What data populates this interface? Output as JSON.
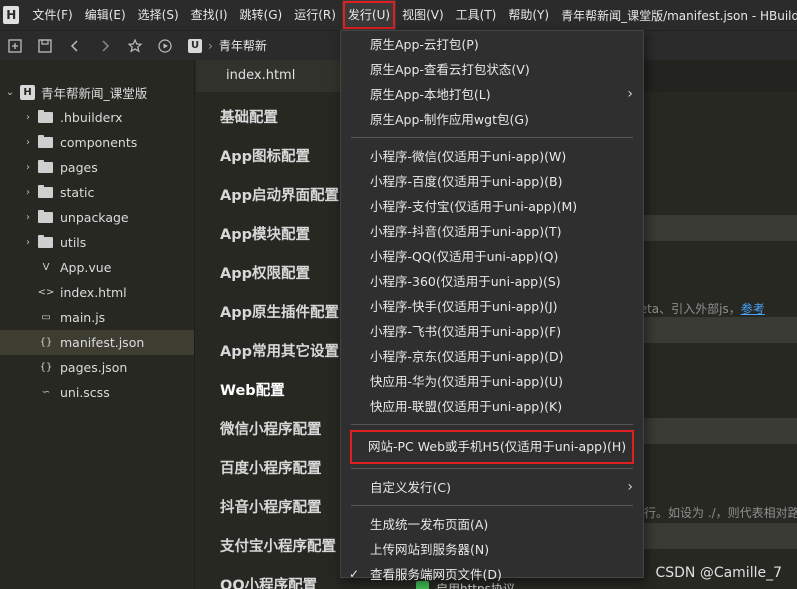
{
  "menubar": {
    "items": [
      {
        "label": "文件(F)"
      },
      {
        "label": "编辑(E)"
      },
      {
        "label": "选择(S)"
      },
      {
        "label": "查找(I)"
      },
      {
        "label": "跳转(G)"
      },
      {
        "label": "运行(R)"
      },
      {
        "label": "发行(U)"
      },
      {
        "label": "视图(V)"
      },
      {
        "label": "工具(T)"
      },
      {
        "label": "帮助(Y)"
      }
    ],
    "window_title": "青年帮新闻_课堂版/manifest.json - HBuilderX"
  },
  "toolbar": {
    "breadcrumb_project": "青年帮新"
  },
  "sidebar": {
    "project_name": "青年帮新闻_课堂版",
    "items": [
      {
        "label": ".hbuilderx",
        "type": "folder"
      },
      {
        "label": "components",
        "type": "folder"
      },
      {
        "label": "pages",
        "type": "folder"
      },
      {
        "label": "static",
        "type": "folder"
      },
      {
        "label": "unpackage",
        "type": "folder"
      },
      {
        "label": "utils",
        "type": "folder"
      },
      {
        "label": "App.vue",
        "type": "vue"
      },
      {
        "label": "index.html",
        "type": "html"
      },
      {
        "label": "main.js",
        "type": "js"
      },
      {
        "label": "manifest.json",
        "type": "json"
      },
      {
        "label": "pages.json",
        "type": "json"
      },
      {
        "label": "uni.scss",
        "type": "scss"
      }
    ]
  },
  "editor": {
    "tab_label": "index.html",
    "config_nav": [
      "基础配置",
      "App图标配置",
      "App启动界面配置",
      "App模块配置",
      "App权限配置",
      "App原生插件配置",
      "App常用其它设置",
      "Web配置",
      "微信小程序配置",
      "百度小程序配置",
      "抖音小程序配置",
      "支付宝小程序配置",
      "QQ小程序配置"
    ],
    "hint_meta": "入meta、引入外部js，",
    "hint_meta_link": "参考",
    "hint_relative": "行。如设为 ./，则代表相对路",
    "https_label": "启用https协议"
  },
  "dropdown": {
    "group1": [
      "原生App-云打包(P)",
      "原生App-查看云打包状态(V)",
      "原生App-本地打包(L)",
      "原生App-制作应用wgt包(G)"
    ],
    "group2": [
      "小程序-微信(仅适用于uni-app)(W)",
      "小程序-百度(仅适用于uni-app)(B)",
      "小程序-支付宝(仅适用于uni-app)(M)",
      "小程序-抖音(仅适用于uni-app)(T)",
      "小程序-QQ(仅适用于uni-app)(Q)",
      "小程序-360(仅适用于uni-app)(S)",
      "小程序-快手(仅适用于uni-app)(J)",
      "小程序-飞书(仅适用于uni-app)(F)",
      "小程序-京东(仅适用于uni-app)(D)",
      "快应用-华为(仅适用于uni-app)(U)",
      "快应用-联盟(仅适用于uni-app)(K)"
    ],
    "web_item": "网站-PC Web或手机H5(仅适用于uni-app)(H)",
    "custom_publish": "自定义发行(C)",
    "group4": [
      "生成统一发布页面(A)",
      "上传网站到服务器(N)",
      "查看服务端网页文件(D)"
    ]
  },
  "watermark": "CSDN @Camille_7",
  "colors": {
    "highlight_border": "#e02020",
    "background": "#272822",
    "menu_bg": "#2f2f2f"
  }
}
